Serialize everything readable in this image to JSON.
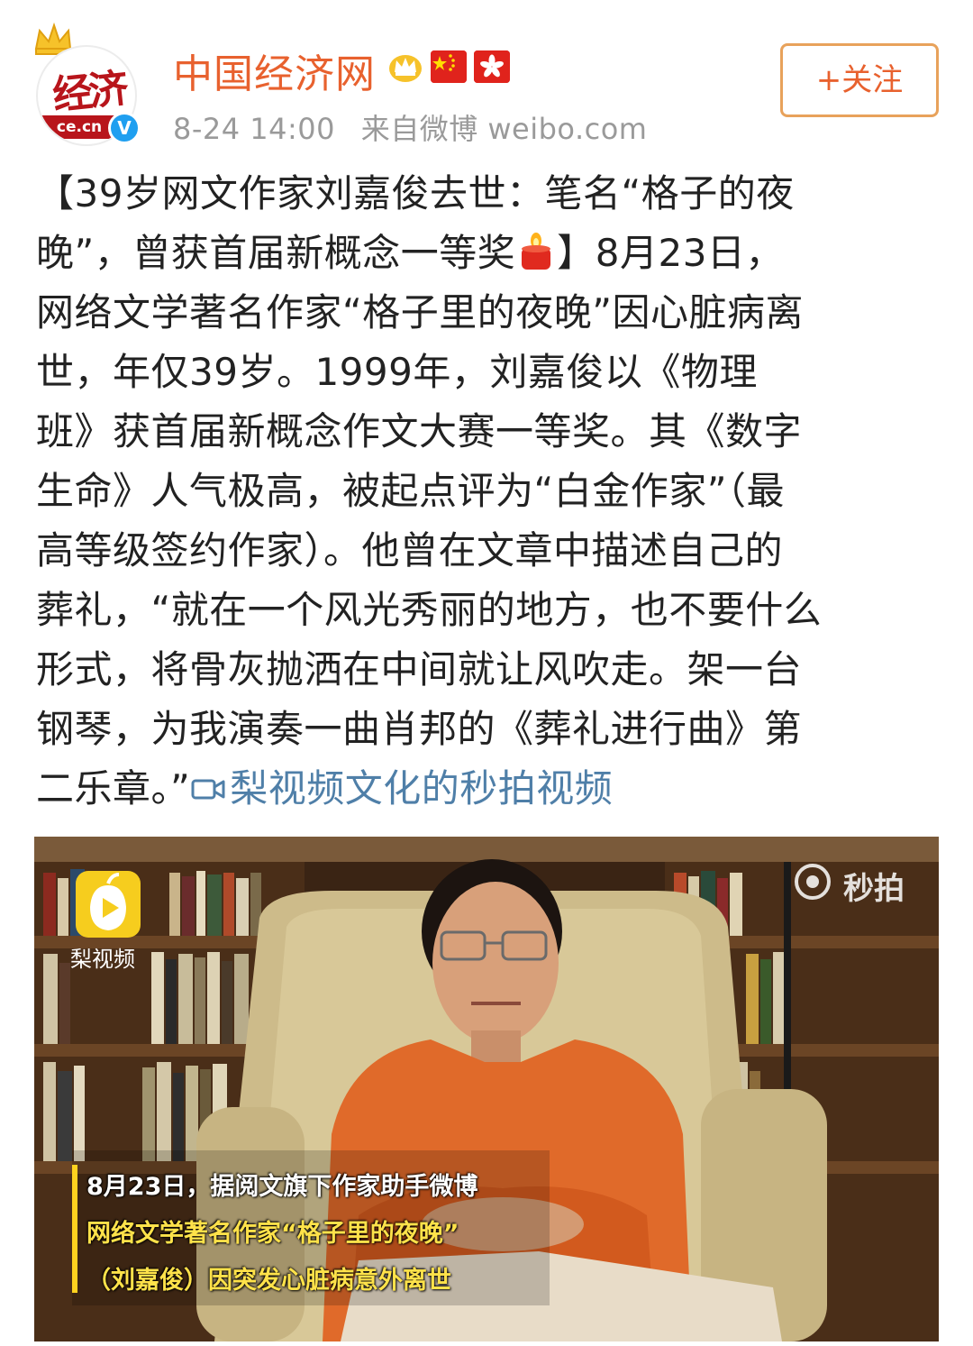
{
  "header": {
    "username": "中国经济网",
    "timestamp": "8-24 14:00",
    "source": "来自微博 weibo.com",
    "follow_label": "+关注",
    "avatar_text": "经济",
    "avatar_domain": "ce.cn",
    "verified_mark": "V"
  },
  "post": {
    "lines": [
      "【39岁网文作家刘嘉俊去世：笔名“格子的夜",
      "晚”，曾获首届新概念一等奖",
      "】8月23日，",
      "网络文学著名作家“格子里的夜晚”因心脏病离",
      "世，年仅39岁。1999年，刘嘉俊以《物理",
      "班》获首届新概念作文大赛一等奖。其《数字",
      "生命》人气极高，被起点评为“白金作家”（最",
      "高等级签约作家）。他曾在文章中描述自己的",
      "葬礼，“就在一个风光秀丽的地方，也不要什么",
      "形式，将骨灰抛洒在中间就让风吹走。架一台",
      "钢琴，为我演奏一曲肖邦的《葬礼进行曲》第",
      "二乐章。”"
    ],
    "video_link": "梨视频文化的秒拍视频"
  },
  "video": {
    "brand_label": "梨视频",
    "watermark": "秒拍",
    "caption_lines": [
      "8月23日，据阅文旗下作家助手微博",
      "网络文学著名作家“格子里的夜晚”",
      "（刘嘉俊）因突发心脏病意外离世"
    ]
  },
  "colors": {
    "username": "#e8612e",
    "follow_border": "#e8a25b",
    "link": "#4f7fa8",
    "meta": "#9a9a9a",
    "caption_yellow": "#ffe24a"
  },
  "icons": [
    "crown-icon",
    "vip-crown-icon",
    "china-flag-icon",
    "hong-kong-flag-icon",
    "verified-icon",
    "candle-icon",
    "video-link-icon",
    "pear-video-logo-icon",
    "miaopai-logo-icon"
  ]
}
